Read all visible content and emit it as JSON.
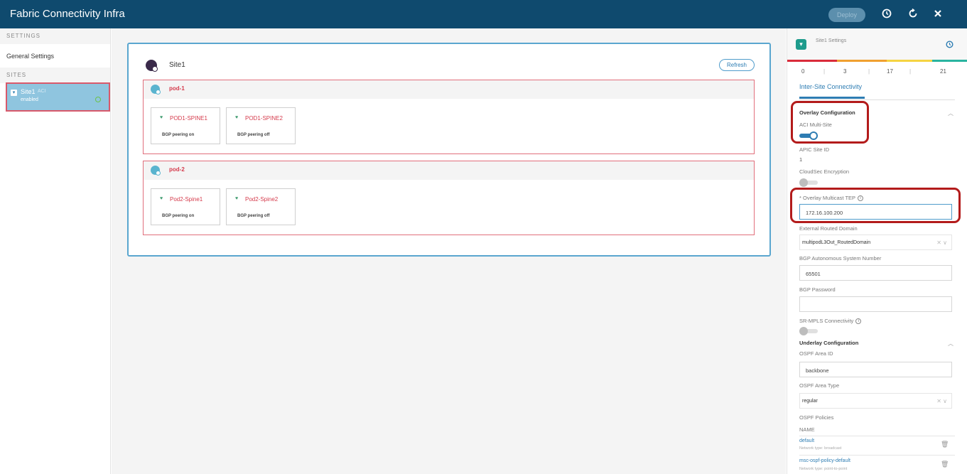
{
  "app": {
    "title": "Fabric Connectivity Infra",
    "deploy_label": "Deploy"
  },
  "header_icons": [
    "history-icon",
    "refresh-icon",
    "close-icon"
  ],
  "sidebar": {
    "settings_section": "SETTINGS",
    "general_settings": "General Settings",
    "sites_section": "SITES",
    "site": {
      "name": "Site1",
      "tag": "ACI",
      "status": "enabled"
    }
  },
  "main": {
    "site_title": "Site1",
    "refresh_label": "Refresh",
    "pods": [
      {
        "name": "pod-1",
        "spines": [
          {
            "name": "POD1-SPINE1",
            "status": "BGP peering on"
          },
          {
            "name": "POD1-SPINE2",
            "status": "BGP peering off"
          }
        ]
      },
      {
        "name": "pod-2",
        "spines": [
          {
            "name": "Pod2-Spine1",
            "status": "BGP peering on"
          },
          {
            "name": "Pod2-Spine2",
            "status": "BGP peering off"
          }
        ]
      }
    ]
  },
  "panel": {
    "title": "Site1 Settings",
    "counters": [
      "0",
      "3",
      "17",
      "21"
    ],
    "counter_separators": [
      "|",
      "|",
      "|"
    ],
    "colors": [
      "#d92b3a",
      "#f0a030",
      "#f5d442",
      "#2ab4a0"
    ],
    "tab": "Inter-Site Connectivity",
    "overlay": {
      "heading": "Overlay Configuration",
      "aci_multisite_label": "ACI Multi-Site",
      "aci_multisite_on": true,
      "apic_site_id_label": "APIC Site ID",
      "apic_site_id": "1",
      "cloudsec_label": "CloudSec Encryption",
      "cloudsec_on": false,
      "multicast_tep_label": "* Overlay Multicast TEP",
      "multicast_tep_value": "172.16.100.200",
      "ext_routed_domain_label": "External Routed Domain",
      "ext_routed_domain_value": "multipodL3Out_RoutedDomain",
      "bgp_asn_label": "BGP Autonomous System Number",
      "bgp_asn_value": "65501",
      "bgp_password_label": "BGP Password",
      "bgp_password_value": "",
      "srmpls_label": "SR-MPLS Connectivity",
      "srmpls_on": false
    },
    "underlay": {
      "heading": "Underlay Configuration",
      "ospf_area_id_label": "OSPF Area ID",
      "ospf_area_id_value": "backbone",
      "ospf_area_type_label": "OSPF Area Type",
      "ospf_area_type_value": "regular",
      "ospf_policies_label": "OSPF Policies",
      "name_col": "NAME",
      "policies": [
        {
          "name": "default",
          "type": "Network type: broadcast"
        },
        {
          "name": "msc-ospf-policy-default",
          "type": "Network type: point-to-point"
        }
      ]
    }
  }
}
